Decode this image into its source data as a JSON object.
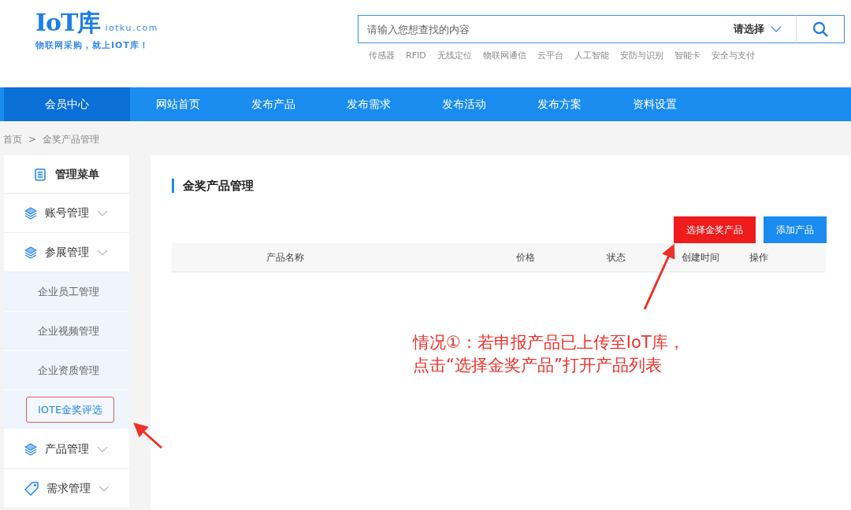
{
  "logo": {
    "mark": "IoT库",
    "domain": "iotku.com",
    "slogan": "物联网采购，就上IOT库！"
  },
  "search": {
    "placeholder": "请输入您想查找的内容",
    "category": "请选择"
  },
  "hot_tags": [
    "传感器",
    "RFID",
    "无线定位",
    "物联网通信",
    "云平台",
    "人工智能",
    "安防与识别",
    "智能卡",
    "安全与支付"
  ],
  "nav": [
    {
      "label": "会员中心",
      "selected": true
    },
    {
      "label": "网站首页",
      "selected": false
    },
    {
      "label": "发布产品",
      "selected": false
    },
    {
      "label": "发布需求",
      "selected": false
    },
    {
      "label": "发布活动",
      "selected": false
    },
    {
      "label": "发布方案",
      "selected": false
    },
    {
      "label": "资料设置",
      "selected": false
    }
  ],
  "breadcrumb": [
    "首页",
    ">",
    "金奖产品管理"
  ],
  "sidebar": {
    "title": "管理菜单",
    "items": [
      {
        "label": "账号管理"
      },
      {
        "label": "参展管理",
        "children": [
          {
            "label": "企业员工管理",
            "selected": false
          },
          {
            "label": "企业视频管理",
            "selected": false
          },
          {
            "label": "企业资质管理",
            "selected": false
          },
          {
            "label": "IOTE金奖评选",
            "selected": true
          }
        ]
      },
      {
        "label": "产品管理"
      },
      {
        "label": "需求管理"
      }
    ]
  },
  "panel": {
    "title": "金奖产品管理",
    "buttons": [
      {
        "label": "选择金奖产品",
        "kind": "danger"
      },
      {
        "label": "添加产品",
        "kind": "primary"
      }
    ],
    "columns": [
      "产品名称",
      "价格",
      "状态",
      "创建时间",
      "操作"
    ]
  },
  "annotation": {
    "lines": [
      "情况①：若申报产品已上传至IoT库，",
      "点击“选择金奖产品”打开产品列表"
    ]
  }
}
